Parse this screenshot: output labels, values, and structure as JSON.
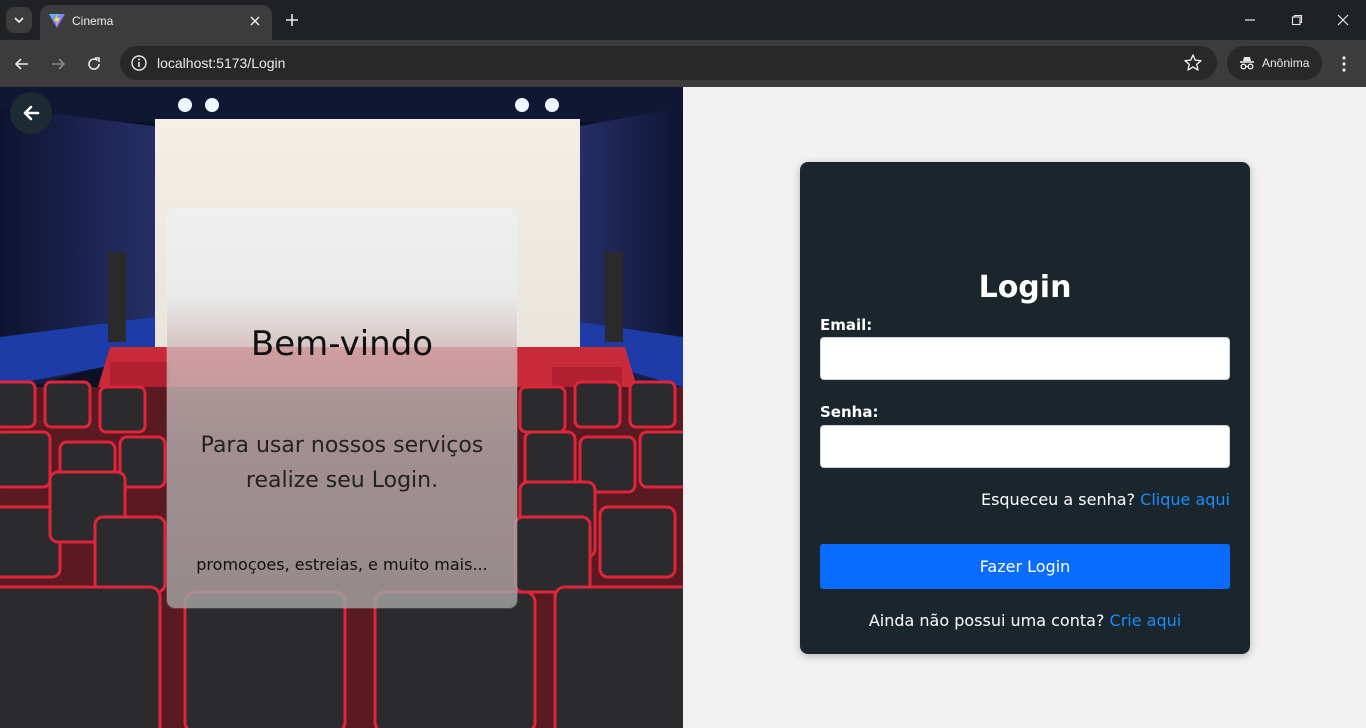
{
  "browser": {
    "tab_title": "Cinema",
    "url_host": "localhost",
    "url_path": ":5173/Login",
    "incognito_label": "Anônima"
  },
  "welcome": {
    "title": "Bem-vindo",
    "message": "Para usar nossos serviços realize seu Login.",
    "footer": "promoçoes, estreias, e muito mais..."
  },
  "login": {
    "title": "Login",
    "email_label": "Email:",
    "email_value": "",
    "password_label": "Senha:",
    "password_value": "",
    "forgot_text": "Esqueceu a senha?",
    "forgot_link": "Clique aqui",
    "submit_label": "Fazer Login",
    "signup_text": "Ainda não possui uma conta?",
    "signup_link": "Crie aqui"
  },
  "colors": {
    "card_bg": "#1b252c",
    "primary_button": "#0a6cff",
    "link": "#1a8cff",
    "page_bg": "#f1f1f1"
  }
}
